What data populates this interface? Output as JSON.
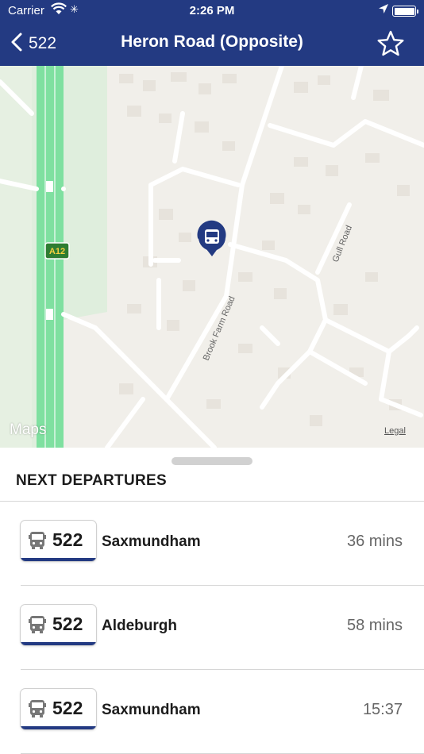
{
  "status_bar": {
    "carrier": "Carrier",
    "time": "2:26 PM"
  },
  "nav": {
    "back_label": "522",
    "title": "Heron Road (Opposite)"
  },
  "map": {
    "road_badge": "A12",
    "roads": [
      "Brook Farm Road",
      "Gull Road"
    ],
    "attribution": "Maps",
    "legal": "Legal"
  },
  "departures": {
    "heading": "NEXT DEPARTURES",
    "items": [
      {
        "route": "522",
        "destination": "Saxmundham",
        "time": "36 mins"
      },
      {
        "route": "522",
        "destination": "Aldeburgh",
        "time": "58 mins"
      },
      {
        "route": "522",
        "destination": "Saxmundham",
        "time": "15:37"
      }
    ]
  },
  "colors": {
    "brand": "#233a82",
    "road_green": "#7fe0a0",
    "map_bg": "#f1efea"
  }
}
